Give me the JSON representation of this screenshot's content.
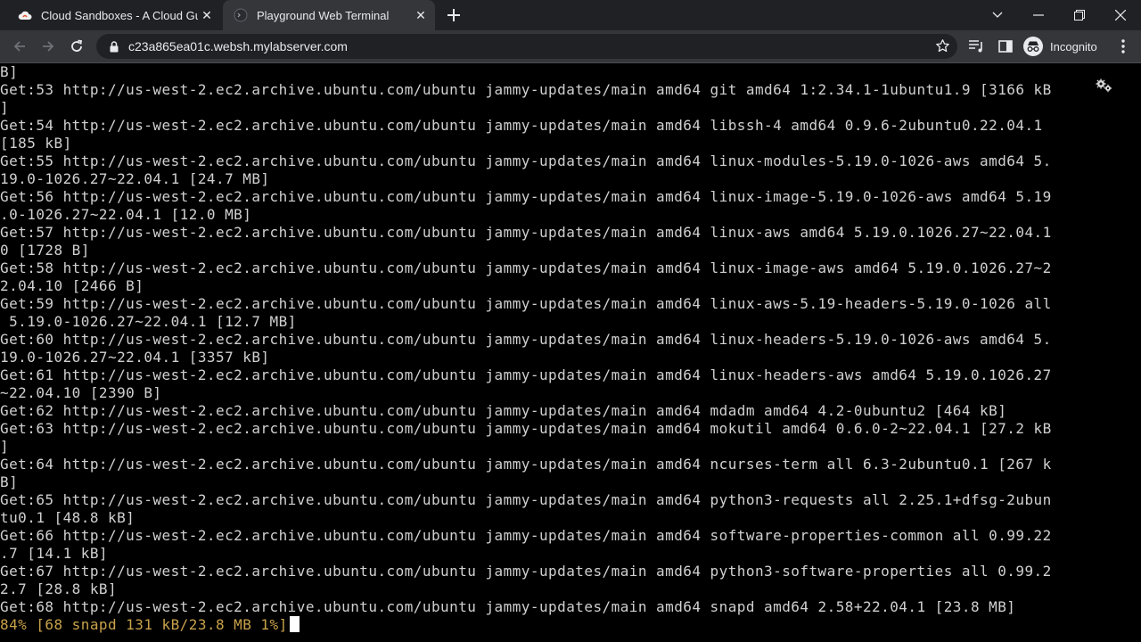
{
  "browser": {
    "tabs": [
      {
        "title": "Cloud Sandboxes - A Cloud Guru",
        "favicon": "cloud-icon",
        "active": false
      },
      {
        "title": "Playground Web Terminal",
        "favicon": "terminal-icon",
        "active": true
      }
    ],
    "url": "c23a865ea01c.websh.mylabserver.com",
    "profile_label": "Incognito"
  },
  "terminal": {
    "lines": [
      "B]",
      "Get:53 http://us-west-2.ec2.archive.ubuntu.com/ubuntu jammy-updates/main amd64 git amd64 1:2.34.1-1ubuntu1.9 [3166 kB",
      "]",
      "Get:54 http://us-west-2.ec2.archive.ubuntu.com/ubuntu jammy-updates/main amd64 libssh-4 amd64 0.9.6-2ubuntu0.22.04.1",
      "[185 kB]",
      "Get:55 http://us-west-2.ec2.archive.ubuntu.com/ubuntu jammy-updates/main amd64 linux-modules-5.19.0-1026-aws amd64 5.",
      "19.0-1026.27~22.04.1 [24.7 MB]",
      "Get:56 http://us-west-2.ec2.archive.ubuntu.com/ubuntu jammy-updates/main amd64 linux-image-5.19.0-1026-aws amd64 5.19",
      ".0-1026.27~22.04.1 [12.0 MB]",
      "Get:57 http://us-west-2.ec2.archive.ubuntu.com/ubuntu jammy-updates/main amd64 linux-aws amd64 5.19.0.1026.27~22.04.1",
      "0 [1728 B]",
      "Get:58 http://us-west-2.ec2.archive.ubuntu.com/ubuntu jammy-updates/main amd64 linux-image-aws amd64 5.19.0.1026.27~2",
      "2.04.10 [2466 B]",
      "Get:59 http://us-west-2.ec2.archive.ubuntu.com/ubuntu jammy-updates/main amd64 linux-aws-5.19-headers-5.19.0-1026 all",
      " 5.19.0-1026.27~22.04.1 [12.7 MB]",
      "Get:60 http://us-west-2.ec2.archive.ubuntu.com/ubuntu jammy-updates/main amd64 linux-headers-5.19.0-1026-aws amd64 5.",
      "19.0-1026.27~22.04.1 [3357 kB]",
      "Get:61 http://us-west-2.ec2.archive.ubuntu.com/ubuntu jammy-updates/main amd64 linux-headers-aws amd64 5.19.0.1026.27",
      "~22.04.10 [2390 B]",
      "Get:62 http://us-west-2.ec2.archive.ubuntu.com/ubuntu jammy-updates/main amd64 mdadm amd64 4.2-0ubuntu2 [464 kB]",
      "Get:63 http://us-west-2.ec2.archive.ubuntu.com/ubuntu jammy-updates/main amd64 mokutil amd64 0.6.0-2~22.04.1 [27.2 kB",
      "]",
      "Get:64 http://us-west-2.ec2.archive.ubuntu.com/ubuntu jammy-updates/main amd64 ncurses-term all 6.3-2ubuntu0.1 [267 k",
      "B]",
      "Get:65 http://us-west-2.ec2.archive.ubuntu.com/ubuntu jammy-updates/main amd64 python3-requests all 2.25.1+dfsg-2ubun",
      "tu0.1 [48.8 kB]",
      "Get:66 http://us-west-2.ec2.archive.ubuntu.com/ubuntu jammy-updates/main amd64 software-properties-common all 0.99.22",
      ".7 [14.1 kB]",
      "Get:67 http://us-west-2.ec2.archive.ubuntu.com/ubuntu jammy-updates/main amd64 python3-software-properties all 0.99.2",
      "2.7 [28.8 kB]",
      "Get:68 http://us-west-2.ec2.archive.ubuntu.com/ubuntu jammy-updates/main amd64 snapd amd64 2.58+22.04.1 [23.8 MB]"
    ],
    "progress": "84% [68 snapd 131 kB/23.8 MB 1%]"
  },
  "colors": {
    "tabstrip_bg": "#202124",
    "toolbar_bg": "#35363a",
    "terminal_bg": "#000000",
    "terminal_fg": "#d0d0d0",
    "progress_fg": "#c8a24a"
  }
}
